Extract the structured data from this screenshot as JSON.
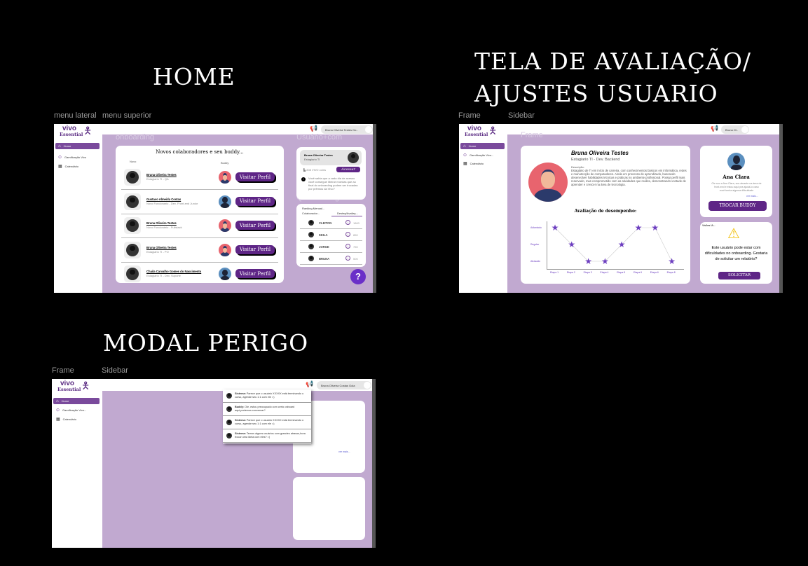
{
  "canvas": {
    "titles": {
      "home": "HOME",
      "avaliacao_1": "TELA DE AVALIAÇÃO/",
      "avaliacao_2": "AJUSTES  USUARIO",
      "modal": "MODAL PERIGO"
    },
    "frame_labels": {
      "home_a": "menu lateral",
      "home_b": "menu superior",
      "aval_a": "Frame",
      "aval_b": "Sidebar",
      "modal_a": "Frame",
      "modal_b": "Sidebar"
    }
  },
  "brand": {
    "name_1": "vivo",
    "name_2": "Essential"
  },
  "sidebar": {
    "items": [
      {
        "label": "Home",
        "icon": "home-icon"
      },
      {
        "label": "Gamificação Vivo",
        "icon": "coin-icon"
      },
      {
        "label": "Calendário",
        "icon": "calendar-icon"
      }
    ],
    "items_short": [
      {
        "label": "Home"
      },
      {
        "label": "Gamificação Vivo..."
      },
      {
        "label": "Calendário"
      }
    ]
  },
  "colors": {
    "purple_bg": "#c1a9d0",
    "brand": "#5e2586",
    "accent": "#6d3fc0"
  },
  "home": {
    "user_pill": "Bruna Oliveira Testes Go..",
    "ghost_left": "onboarding",
    "ghost_right": "Usuário+com",
    "ghost_right2": "Quadro de gamific",
    "list_title": "Novos colaboradores e seu buddy...",
    "col_new": "Novo",
    "col_buddy": "Buddy",
    "visit_label": "Visitar Perfil",
    "rows": [
      {
        "name": "Bruna Oliveira Testes",
        "role": "Estagiario TI - QA",
        "buddy": "male"
      },
      {
        "name": "Gustavo Almeida Costas",
        "role": "Novo Funcionario - Dev. Front-end Junior",
        "buddy": "fem"
      },
      {
        "name": "Bruna Oliveira Testes",
        "role": "Novo Funcionário - Fullstack",
        "buddy": "male"
      },
      {
        "name": "Bruna Oliveira Testes",
        "role": "Estagiário TI - PO",
        "buddy": "male"
      },
      {
        "name": "Chaila Carvalho Gomes do Nascimento",
        "role": "Estagiário TI - Dev. Suporte",
        "buddy": "fem"
      }
    ],
    "profile": {
      "name": "Bruna Oliveira Testes",
      "role": "Estagiario TI",
      "coins": "208 VIVO coins",
      "access": "Acessar",
      "tip": "Você sabia que a cada dia de acesso você consegue liberar moedas que ao final do onboarding podem ser trocadas por prêmios da Vivo?"
    },
    "ranking": {
      "title": "Ranking Mensal...",
      "col_1": "Colaborador...",
      "col_2": "Destaq/Avaliaç...",
      "rows": [
        {
          "name": "CLEITON",
          "score": "1800"
        },
        {
          "name": "KEILA",
          "score": "850"
        },
        {
          "name": "JORGE",
          "score": "750"
        },
        {
          "name": "BRUNA",
          "score": "500"
        }
      ]
    },
    "help": "?"
  },
  "avaliacao": {
    "user_pill": "Bruna Ol..",
    "ghost": "Frame",
    "name": "Bruna Oliveira Testes",
    "role": "Estagiario TI - Dev. Backend",
    "desc_label": "Descrição:",
    "description": "Estagiário de TI em início de carreira, com conhecimentos básicos em informática, redes e manutenção de computadores. Ainda em processo de aprendizado, buscando desenvolver habilidades técnicas e práticas no ambiente profissional. Possui perfil mais reservado, mas comprometido com as atividades que realiza, demonstrando vontade de aprender e crescer na área de tecnologia.",
    "buddy": {
      "name": "Ana Clara",
      "bio": "Oie sou a Ana Clara, sou atuante na área de front-end e estou aqui pra ajudá-lo caso você tenha alguma dificuldade",
      "more": "ver mais...",
      "button": "TROCAR BUDDY"
    },
    "alert": {
      "header": "Visões IA...",
      "text": "Este usuário pode estar com dificuldades no onboarding. Gostaria de solicitar um relatório?",
      "button": "SOLICITAR",
      "icon": "warning-icon"
    }
  },
  "chart_data": {
    "type": "line",
    "title": "Avaliação de desempenho:",
    "categories": [
      "Etapa 1",
      "Etapa 2",
      "Etapa 3",
      "Etapa 4",
      "Etapa 5",
      "Etapa 6",
      "Etapa 6",
      "Etapa 8"
    ],
    "y_levels": [
      "Atrasado",
      "Regular",
      "Adiantado"
    ],
    "values": [
      "Adiantado",
      "Regular",
      "Atrasado",
      "Atrasado",
      "Regular",
      "Adiantado",
      "Adiantado",
      "Atrasado"
    ],
    "marker": "star",
    "grid": false
  },
  "modal": {
    "user_pill": "Bruna Oliveira Costas Gola",
    "more": "ver mais...",
    "messages": [
      {
        "sender": "Sistema:",
        "text": "Parece que o usuário XXXXX está terminando o curso, agende seu 1:1 com ele =)"
      },
      {
        "sender": "Buddy:",
        "text": "Oie, estou preocupado com certo onboard aqui,podemos conversar?"
      },
      {
        "sender": "Sistema:",
        "text": "Parece que o usuário XXXXX está terminando o curso, agende seu 1:1 com ele =)"
      },
      {
        "sender": "Sistema:",
        "text": "Temos alguns usuários com grandes atrasos,bora trocar uma ideia com eles? =)"
      }
    ]
  }
}
